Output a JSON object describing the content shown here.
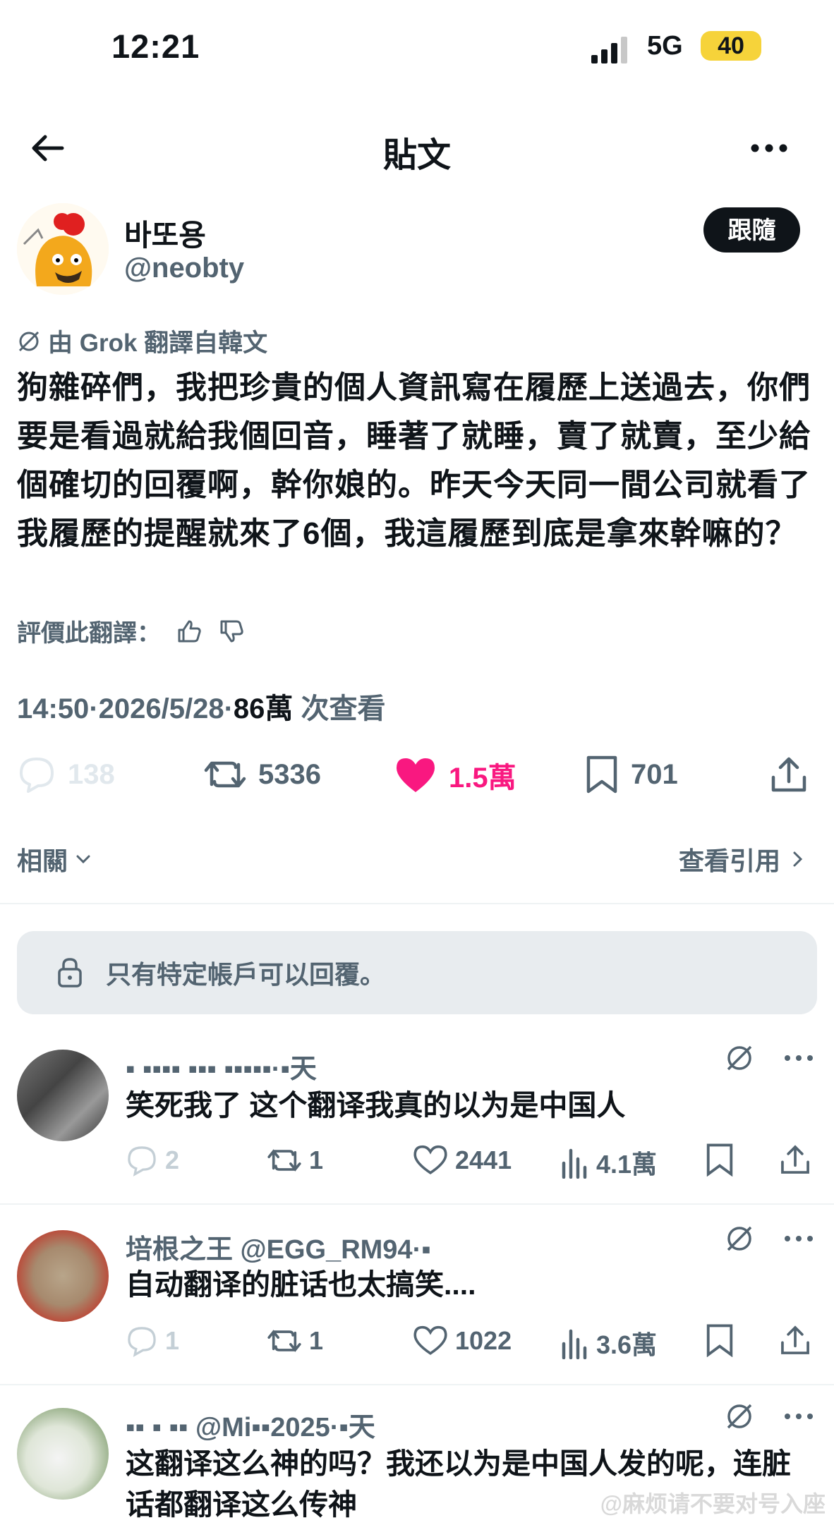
{
  "status_bar": {
    "time": "12:21",
    "network": "5G",
    "battery": "40"
  },
  "header": {
    "title": "貼文"
  },
  "author": {
    "name": "바또용",
    "handle": "@neobty",
    "follow_label": "跟隨"
  },
  "translation_note": "由 Grok 翻譯自韓文",
  "post_text": "狗雜碎們，我把珍貴的個人資訊寫在履歷上送過去，你們要是看過就給我個回音，睡著了就睡，賣了就賣，至少給個確切的回覆啊，幹你娘的。昨天今天同一間公司就看了我履歷的提醒就來了6個，我這履歷到底是拿來幹嘛的？",
  "rate_label": "評價此翻譯：",
  "meta": {
    "time": "14:50",
    "date": "2026/5/28",
    "views": "86萬",
    "views_label": "次查看"
  },
  "stats": {
    "replies": "138",
    "reposts": "5336",
    "likes": "1.5萬",
    "bookmarks": "701"
  },
  "related_label": "相關",
  "quotes_label": "查看引用",
  "restricted_notice": "只有特定帳戶可以回覆。",
  "replies": [
    {
      "name": "▪ ▪▪▪▪ ▪▪▪ ▪▪▪▪▪·▪天",
      "text": "笑死我了 这个翻译我真的以为是中国人",
      "replies": "2",
      "reposts": "1",
      "likes": "2441",
      "views": "4.1萬"
    },
    {
      "name": "培根之王 @EGG_RM94·▪",
      "text": "自动翻译的脏话也太搞笑....",
      "replies": "1",
      "reposts": "1",
      "likes": "1022",
      "views": "3.6萬"
    },
    {
      "name": "▪▪ ▪ ▪▪ @Mi▪▪2025·▪天",
      "text": "这翻译这么神的吗？我还以为是中国人发的呢，连脏话都翻译这么传神"
    }
  ],
  "watermark": "@麻烦请不要对号入座",
  "colors": {
    "like": "#f91880",
    "text": "#0f1419",
    "muted": "#536471",
    "battery": "#f6d33a"
  }
}
